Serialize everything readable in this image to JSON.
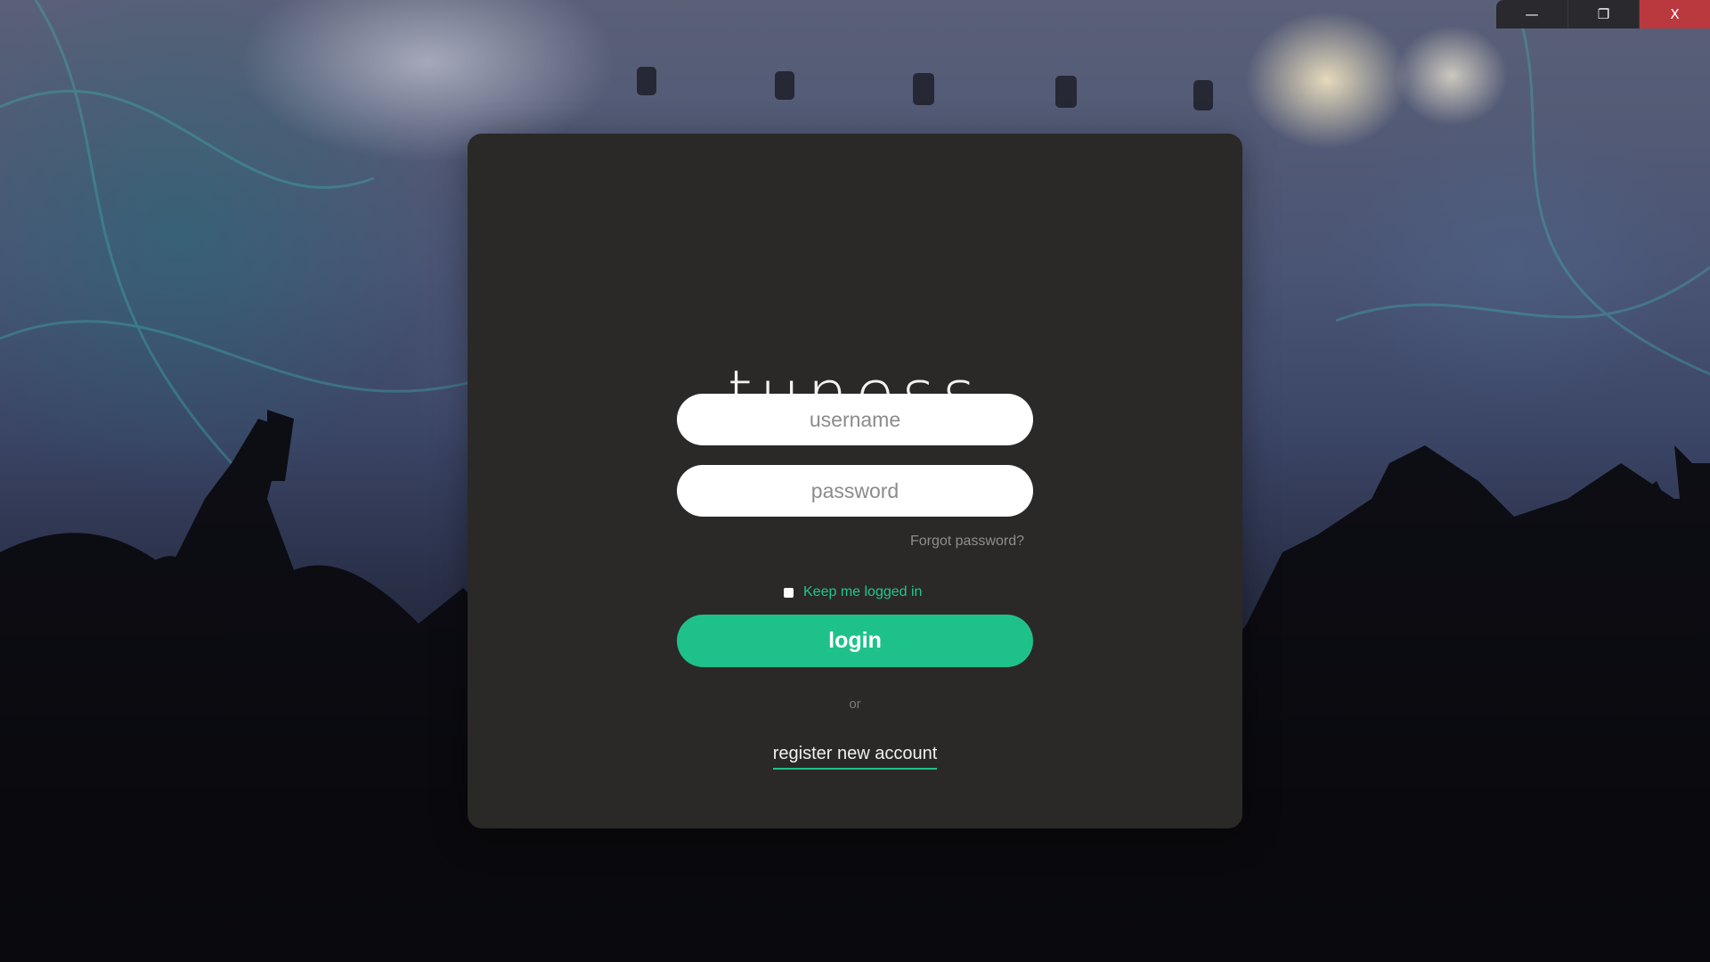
{
  "window_controls": {
    "minimize_icon": "—",
    "maximize_icon": "❐",
    "close_icon": "X"
  },
  "logo": {
    "text": "tuness"
  },
  "login_form": {
    "username_placeholder": "username",
    "password_placeholder": "password",
    "forgot_password_label": "Forgot password?",
    "keep_logged_in_label": "Keep me logged in",
    "login_button_label": "login",
    "separator_label": "or",
    "register_link_label": "register new account"
  },
  "colors": {
    "accent": "#1fc18a",
    "card_background": "#2a2928",
    "close_button": "#b9393f"
  }
}
